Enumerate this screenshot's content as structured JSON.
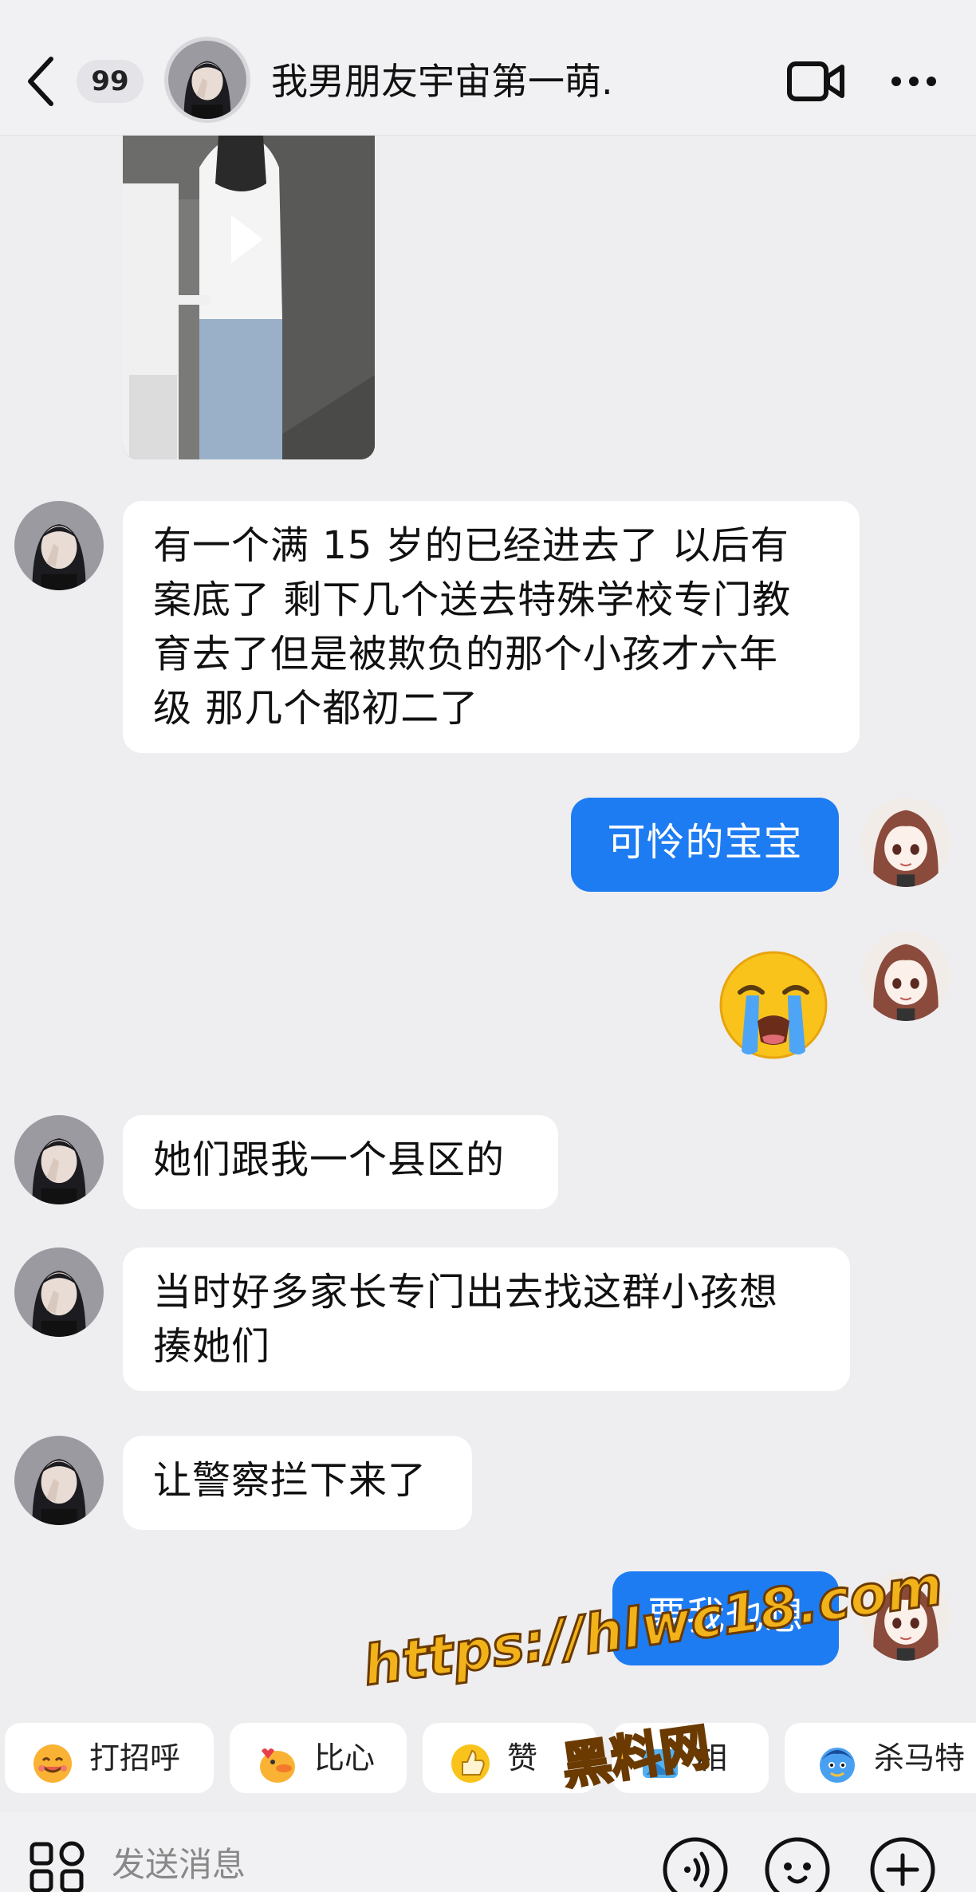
{
  "header": {
    "unread_count": "99",
    "title": "我男朋友宇宙第一萌."
  },
  "messages": [
    {
      "type": "video",
      "side": "incoming"
    },
    {
      "type": "text",
      "side": "incoming",
      "lines": [
        "有一个满 15 岁的已经进去了 以后有",
        "案底了 剩下几个送去特殊学校专门教",
        "育去了但是被欺负的那个小孩才六年",
        "级 那几个都初二了"
      ]
    },
    {
      "type": "text",
      "side": "outgoing",
      "text": "可怜的宝宝"
    },
    {
      "type": "emoji",
      "side": "outgoing",
      "icon": "loudly-crying-face"
    },
    {
      "type": "text",
      "side": "incoming",
      "text": "她们跟我一个县区的"
    },
    {
      "type": "text",
      "side": "incoming",
      "lines": [
        "当时好多家长专门出去找这群小孩想",
        "揍她们"
      ]
    },
    {
      "type": "text",
      "side": "incoming",
      "text": "让警察拦下来了"
    },
    {
      "type": "text",
      "side": "outgoing",
      "text": "要我也想"
    }
  ],
  "quick_replies": [
    {
      "icon": "smiling-face",
      "label": "打招呼"
    },
    {
      "icon": "duck-heart",
      "label": "比心"
    },
    {
      "icon": "thumbs-up",
      "label": "赞"
    },
    {
      "icon": "photo",
      "label": "相"
    },
    {
      "icon": "blue-character",
      "label": "杀马特"
    }
  ],
  "input": {
    "placeholder": "发送消息"
  },
  "watermark": {
    "url": "https://hlwc18.com",
    "name": "黑料网"
  },
  "colors": {
    "background": "#eeeef0",
    "outgoing_bubble": "#1e7cf2",
    "incoming_bubble": "#ffffff",
    "watermark": "#f2b21a"
  }
}
